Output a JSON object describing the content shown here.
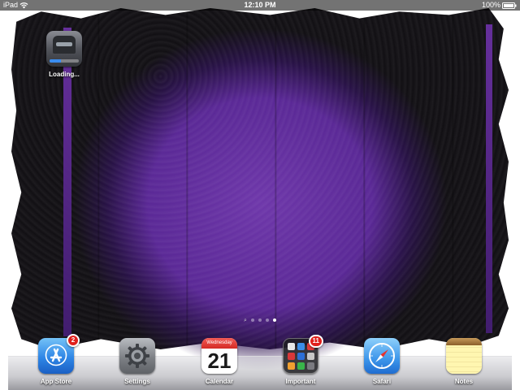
{
  "status_bar": {
    "device": "iPad",
    "time": "12:10 PM",
    "battery": "100%"
  },
  "home_screen": {
    "apps": [
      {
        "label": "Loading...",
        "icon": "game-app-icon",
        "progress": 0.4
      }
    ]
  },
  "page_indicator": {
    "pages": 4,
    "current_page": 4,
    "search": "search-icon"
  },
  "dock": {
    "items": [
      {
        "label": "App Store",
        "icon": "app-store-icon",
        "badge": "2"
      },
      {
        "label": "Settings",
        "icon": "gear-icon"
      },
      {
        "label": "Calendar",
        "icon": "calendar-icon",
        "weekday": "Wednesday",
        "day": "21"
      },
      {
        "label": "Important",
        "icon": "folder-icon",
        "badge": "11"
      },
      {
        "label": "Safari",
        "icon": "compass-icon"
      },
      {
        "label": "Notes",
        "icon": "notes-icon"
      }
    ]
  },
  "colors": {
    "wallpaper_purple": "#5c2896",
    "badge_red": "#e0201c",
    "status_bar": "#000000"
  }
}
